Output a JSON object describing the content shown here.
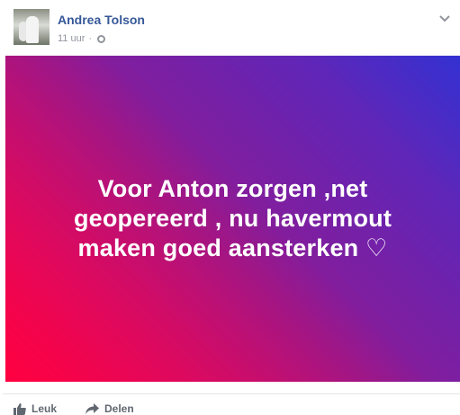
{
  "post": {
    "author": "Andrea Tolson",
    "time": "11 uur",
    "separator": "·",
    "privacy_icon": "globe-icon",
    "menu_icon": "chevron-down-icon",
    "banner_text": "Voor Anton zorgen ,net geopereerd , nu havermout maken goed aansterken ♡",
    "banner_gradient": [
      "#ff0040",
      "#8f1a93",
      "#3331d2"
    ]
  },
  "actions": {
    "like_label": "Leuk",
    "share_label": "Delen"
  }
}
